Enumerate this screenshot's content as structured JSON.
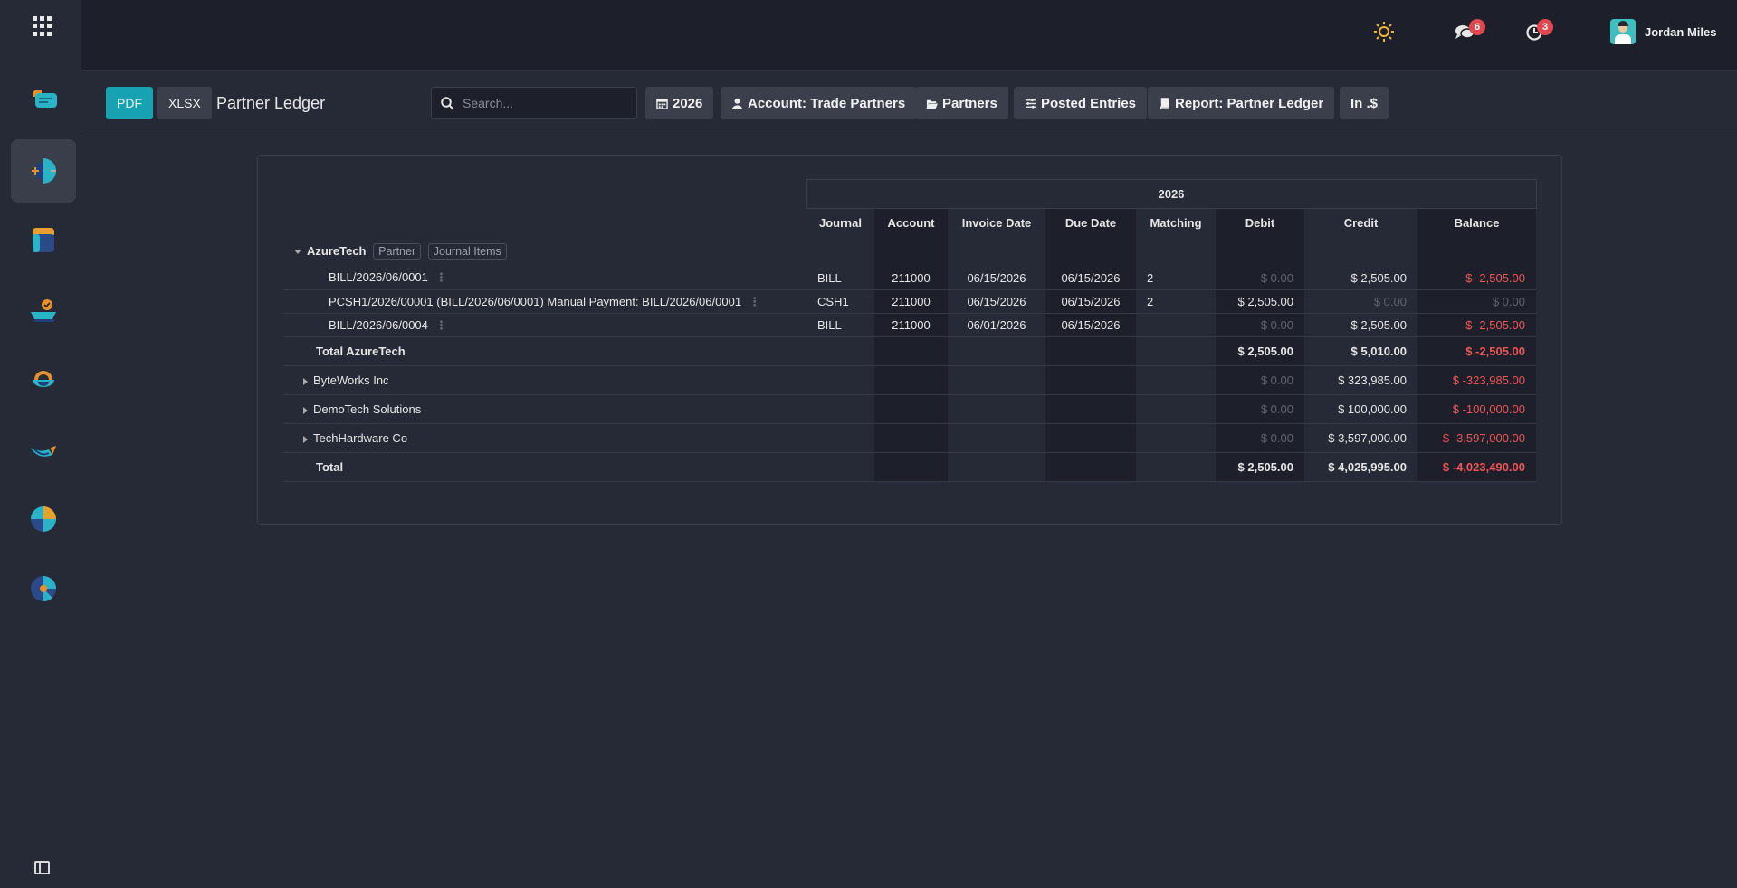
{
  "topbar": {
    "notifications": {
      "messages_count": "6",
      "activities_count": "3"
    },
    "user_name": "Jordan Miles"
  },
  "controls": {
    "pdf_label": "PDF",
    "xlsx_label": "XLSX",
    "title": "Partner Ledger",
    "search_placeholder": "Search...",
    "filters": {
      "year": "2026",
      "account": "Account: Trade Partners",
      "partners": "Partners",
      "posted": "Posted Entries",
      "report": "Report: Partner Ledger",
      "currency": "In .$"
    }
  },
  "report": {
    "year_header": "2026",
    "columns": {
      "journal": "Journal",
      "account": "Account",
      "invoice_date": "Invoice Date",
      "due_date": "Due Date",
      "matching": "Matching",
      "debit": "Debit",
      "credit": "Credit",
      "balance": "Balance"
    },
    "group": {
      "name": "AzureTech",
      "tag_partner": "Partner",
      "tag_items": "Journal Items",
      "lines": [
        {
          "label": "BILL/2026/06/0001",
          "journal": "BILL",
          "account": "211000",
          "invoice_date": "06/15/2026",
          "due_date": "06/15/2026",
          "matching": "2",
          "debit": "$ 0.00",
          "credit": "$ 2,505.00",
          "balance": "$ -2,505.00"
        },
        {
          "label": "PCSH1/2026/00001 (BILL/2026/06/0001) Manual Payment: BILL/2026/06/0001",
          "journal": "CSH1",
          "account": "211000",
          "invoice_date": "06/15/2026",
          "due_date": "06/15/2026",
          "matching": "2",
          "debit": "$ 2,505.00",
          "credit": "$ 0.00",
          "balance": "$ 0.00"
        },
        {
          "label": "BILL/2026/06/0004",
          "journal": "BILL",
          "account": "211000",
          "invoice_date": "06/01/2026",
          "due_date": "06/15/2026",
          "matching": "",
          "debit": "$ 0.00",
          "credit": "$ 2,505.00",
          "balance": "$ -2,505.00"
        }
      ],
      "total": {
        "label": "Total AzureTech",
        "debit": "$ 2,505.00",
        "credit": "$ 5,010.00",
        "balance": "$ -2,505.00"
      }
    },
    "partners": [
      {
        "name": "ByteWorks Inc",
        "debit": "$ 0.00",
        "credit": "$ 323,985.00",
        "balance": "$ -323,985.00"
      },
      {
        "name": "DemoTech Solutions",
        "debit": "$ 0.00",
        "credit": "$ 100,000.00",
        "balance": "$ -100,000.00"
      },
      {
        "name": "TechHardware Co",
        "debit": "$ 0.00",
        "credit": "$ 3,597,000.00",
        "balance": "$ -3,597,000.00"
      }
    ],
    "grand_total": {
      "label": "Total",
      "debit": "$ 2,505.00",
      "credit": "$ 4,025,995.00",
      "balance": "$ -4,023,490.00"
    }
  },
  "colors": {
    "accent": "#17a2b4",
    "negative": "#ee5555",
    "badge": "#e0484e",
    "background": "#262a36",
    "topbar": "#1d202a"
  }
}
